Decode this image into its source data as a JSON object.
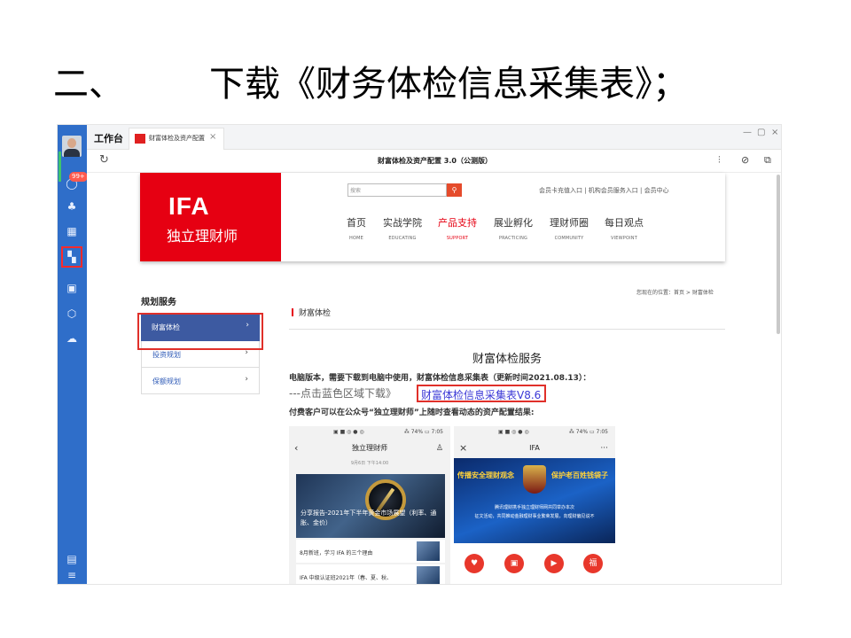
{
  "slide": {
    "number": "二、",
    "title": "下载《财务体检信息采集表》；"
  },
  "window": {
    "workbench_label": "工作台",
    "tab_label": "财富体检及资产配置",
    "tab_close": "×",
    "controls": [
      "—",
      "▢",
      "×"
    ],
    "page_title": "财富体检及资产配置 3.0（公测版）",
    "badge": "99+"
  },
  "site": {
    "brand_logo": "IFA",
    "brand_name": "独立理财师",
    "search_placeholder": "搜索",
    "top_links": "会员卡充值入口 | 机构会员服务入口 | 会员中心",
    "nav": [
      {
        "cn": "首页",
        "en": "HOME"
      },
      {
        "cn": "实战学院",
        "en": "EDUCATING"
      },
      {
        "cn": "产品支持",
        "en": "SUPPORT"
      },
      {
        "cn": "展业孵化",
        "en": "PRACTICING"
      },
      {
        "cn": "理财师圈",
        "en": "COMMUNITY"
      },
      {
        "cn": "每日观点",
        "en": "VIEWPOINT"
      }
    ],
    "active_nav": 2,
    "accent_color": "#e60012"
  },
  "sidebar_menu": {
    "title": "规划服务",
    "items": [
      "财富体检",
      "投资规划",
      "保额规划"
    ],
    "arrow": "›"
  },
  "main": {
    "breadcrumb": "您现在的位置：首页 > 财富体检",
    "section": "财富体检",
    "service_title": "财富体检服务",
    "line1": "电脑版本，需要下载到电脑中使用，财富体检信息采集表（更新时间2021.08.13）：",
    "line2_prefix": "---点击蓝色区域下载》",
    "download_link": "财富体检信息采集表V8.6",
    "line3": "付费客户可以在公众号“独立理财师”上随时查看动态的资产配置结果:"
  },
  "phone1": {
    "status_left": "▣ ■ ◎ ● ◎",
    "status_right": "⁂ 74% ▭ 7:05",
    "back": "‹",
    "title": "独立理财师",
    "user": "♙",
    "date": "9月6日 下午14:00",
    "banner_caption": "分享报告-2021年下半年黄金市场展望（利率、通胀、金价）",
    "items": [
      "8月新班，学习 IFA 的三个理由",
      "IFA 中级认证班2021年（春、夏、秋、"
    ]
  },
  "phone2": {
    "status_left": "▣ ■ ◎ ● ◎",
    "status_right": "⁂ 74% ▭ 7:05",
    "close": "×",
    "title": "IFA",
    "more": "···",
    "slogan_left": "传播安全理财观念",
    "slogan_right": "保护老百姓钱袋子",
    "sub1": "腾讯理财携手独立理财师网共同举办本次",
    "sub2": "征文活动，共同推动金融理财事业繁荣发展，向理财偏见说不",
    "icon_glyphs": [
      "♥",
      "▣",
      "▶",
      "福"
    ]
  }
}
